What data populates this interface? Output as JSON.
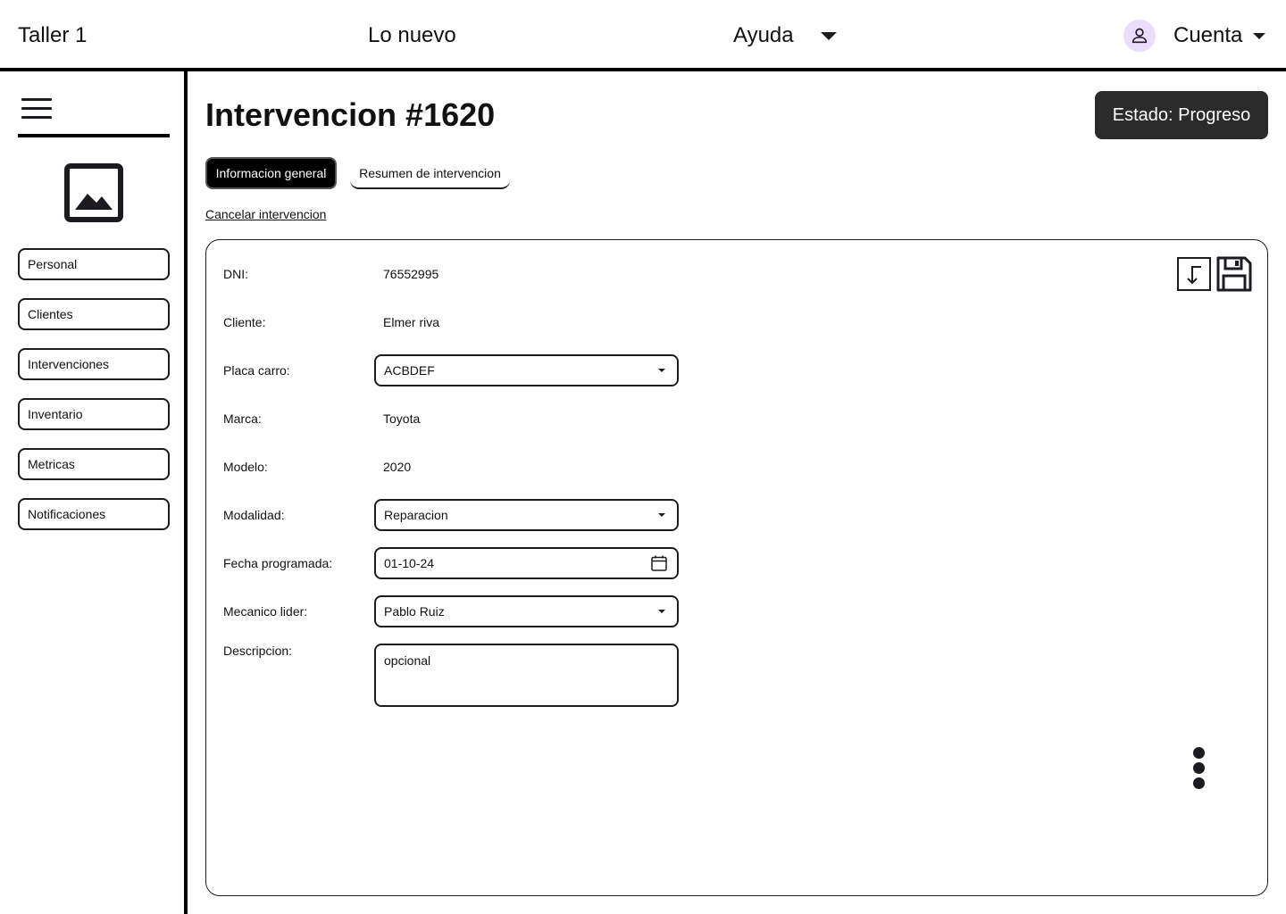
{
  "topbar": {
    "brand": "Taller 1",
    "nav_new": "Lo nuevo",
    "nav_help": "Ayuda",
    "account": "Cuenta"
  },
  "sidebar": {
    "items": [
      {
        "label": "Personal"
      },
      {
        "label": "Clientes"
      },
      {
        "label": "Intervenciones"
      },
      {
        "label": "Inventario"
      },
      {
        "label": "Metricas"
      },
      {
        "label": "Notificaciones"
      }
    ]
  },
  "main": {
    "title": "Intervencion #1620",
    "status_button": "Estado: Progreso",
    "tabs": [
      {
        "label": "Informacion general",
        "active": true
      },
      {
        "label": "Resumen de intervencion",
        "active": false
      }
    ],
    "cancel_link": "Cancelar intervencion"
  },
  "form": {
    "dni": {
      "label": "DNI:",
      "value": "76552995"
    },
    "cliente": {
      "label": "Cliente:",
      "value": "Elmer riva"
    },
    "placa": {
      "label": "Placa carro:",
      "value": "ACBDEF"
    },
    "marca": {
      "label": "Marca:",
      "value": "Toyota"
    },
    "modelo": {
      "label": "Modelo:",
      "value": "2020"
    },
    "modalidad": {
      "label": "Modalidad:",
      "value": "Reparacion"
    },
    "fecha": {
      "label": "Fecha programada:",
      "value": "01-10-24"
    },
    "mecanico": {
      "label": "Mecanico lider:",
      "value": "Pablo Ruiz"
    },
    "descripcion": {
      "label": "Descripcion:",
      "value": "opcional"
    }
  },
  "icons": {
    "avatar": "person-icon",
    "menu": "hamburger-icon",
    "logo": "image-placeholder-icon",
    "import": "import-icon",
    "save": "save-icon",
    "more": "more-vertical-icon",
    "calendar": "calendar-icon"
  },
  "colors": {
    "status_button_bg": "#2b2b2b",
    "avatar_bg": "#eaddff",
    "active_tab_bg": "#000000"
  }
}
